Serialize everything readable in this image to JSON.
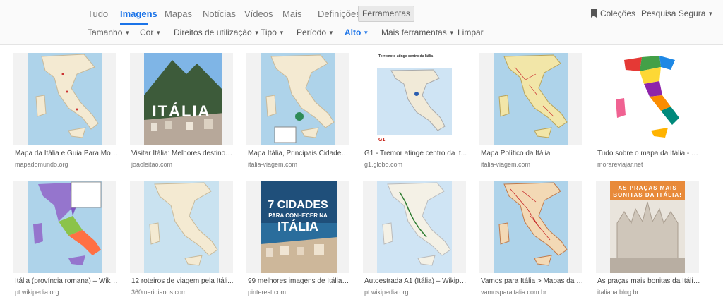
{
  "nav": {
    "tabs": [
      "Tudo",
      "Imagens",
      "Mapas",
      "Notícias",
      "Vídeos",
      "Mais",
      "Definições"
    ],
    "tools_label": "Ferramentas",
    "collections_label": "Coleções",
    "safesearch_label": "Pesquisa Segura"
  },
  "filters": [
    "Tamanho",
    "Cor",
    "Direitos de utilização",
    "Tipo",
    "Período",
    "Alto",
    "Mais ferramentas",
    "Limpar"
  ],
  "results": [
    {
      "caption": "Mapa da Itália e Guia Para Mon...",
      "domain": "mapadomundo.org"
    },
    {
      "caption": "Visitar Itália: Melhores destinos...",
      "domain": "joaoleitao.com",
      "overlay": "ITÁLIA"
    },
    {
      "caption": "Mapa Itália, Principais Cidades ...",
      "domain": "italia-viagem.com"
    },
    {
      "caption": "G1 - Tremor atinge centro da It...",
      "domain": "g1.globo.com",
      "overlay": "Terremoto atinge centro da Itália",
      "logo": "G1"
    },
    {
      "caption": "Mapa Político da Itália",
      "domain": "italia-viagem.com"
    },
    {
      "caption": "Tudo sobre o mapa da Itália - M...",
      "domain": "morareviajar.net"
    },
    {
      "caption": "Itália (província romana) – Wiki...",
      "domain": "pt.wikipedia.org"
    },
    {
      "caption": "12 roteiros de viagem pela Itáli...",
      "domain": "360meridianos.com"
    },
    {
      "caption": "99 melhores imagens de Itália |...",
      "domain": "pinterest.com",
      "overlay": "7 CIDADES",
      "overlay2": "PARA CONHECER NA",
      "overlay3": "ITÁLIA"
    },
    {
      "caption": "Autoestrada A1 (Itália) – Wikipé...",
      "domain": "pt.wikipedia.org"
    },
    {
      "caption": "Vamos para Itália > Mapas da It...",
      "domain": "vamosparaitalia.com.br"
    },
    {
      "caption": "As praças mais bonitas da Itália ...",
      "domain": "italiana.blog.br",
      "overlay": "AS PRAÇAS MAIS",
      "overlay2": "BONITAS DA ITÁLIA!"
    }
  ],
  "colors": {
    "accent": "#1a73e8",
    "sea": "#aed3ea",
    "land": "#f4ead2"
  }
}
